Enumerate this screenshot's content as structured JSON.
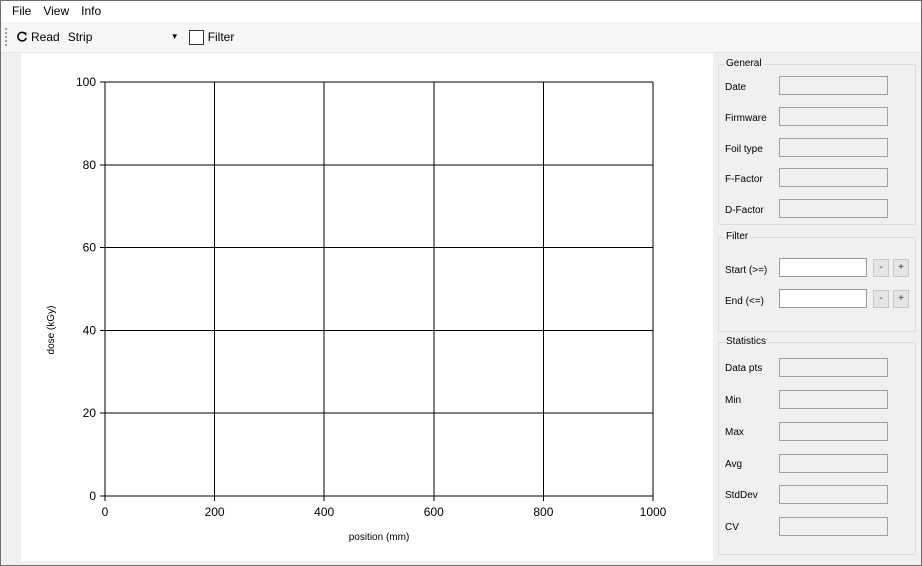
{
  "menu": {
    "file": "File",
    "view": "View",
    "info": "Info"
  },
  "toolbar": {
    "read_label": "Read",
    "mode_selected": "Strip",
    "filter_label": "Filter",
    "filter_checked": false
  },
  "chart_data": {
    "type": "line",
    "title": "",
    "xlabel": "position (mm)",
    "ylabel": "dose (kGy)",
    "xlim": [
      0,
      1000
    ],
    "ylim": [
      0,
      100
    ],
    "x_ticks": [
      0,
      200,
      400,
      600,
      800,
      1000
    ],
    "y_ticks": [
      0,
      20,
      40,
      60,
      80,
      100
    ],
    "grid": true,
    "series": []
  },
  "general": {
    "title": "General",
    "fields": [
      {
        "label": "Date",
        "value": ""
      },
      {
        "label": "Firmware",
        "value": ""
      },
      {
        "label": "Foil type",
        "value": ""
      },
      {
        "label": "F-Factor",
        "value": ""
      },
      {
        "label": "D-Factor",
        "value": ""
      }
    ]
  },
  "filter": {
    "title": "Filter",
    "start_label": "Start (>=)",
    "start_value": "",
    "end_label": "End  (<=)",
    "end_value": "",
    "minus": "-",
    "plus": "+"
  },
  "statistics": {
    "title": "Statistics",
    "fields": [
      {
        "label": "Data pts",
        "value": ""
      },
      {
        "label": "Min",
        "value": ""
      },
      {
        "label": "Max",
        "value": ""
      },
      {
        "label": "Avg",
        "value": ""
      },
      {
        "label": "StdDev",
        "value": ""
      },
      {
        "label": "CV",
        "value": ""
      }
    ]
  }
}
